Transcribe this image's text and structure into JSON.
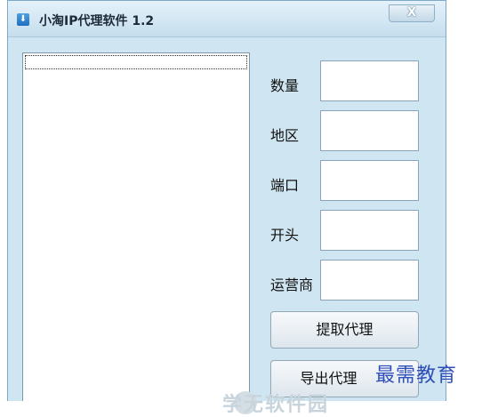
{
  "window": {
    "title": "小淘IP代理软件 1.2",
    "close_label": "X"
  },
  "form": {
    "count_label": "数量",
    "count_value": "",
    "region_label": "地区",
    "region_value": "",
    "port_label": "端口",
    "port_value": "",
    "prefix_label": "开头",
    "prefix_value": "",
    "carrier_label": "运营商",
    "carrier_value": ""
  },
  "buttons": {
    "fetch_label": "提取代理",
    "export_label": "导出代理"
  },
  "watermarks": {
    "faint_text": "学无软件园",
    "corner_text": "最需教育"
  },
  "colors": {
    "window_bg": "#cfe5f1",
    "watermark_blue": "#2f4fb8"
  }
}
